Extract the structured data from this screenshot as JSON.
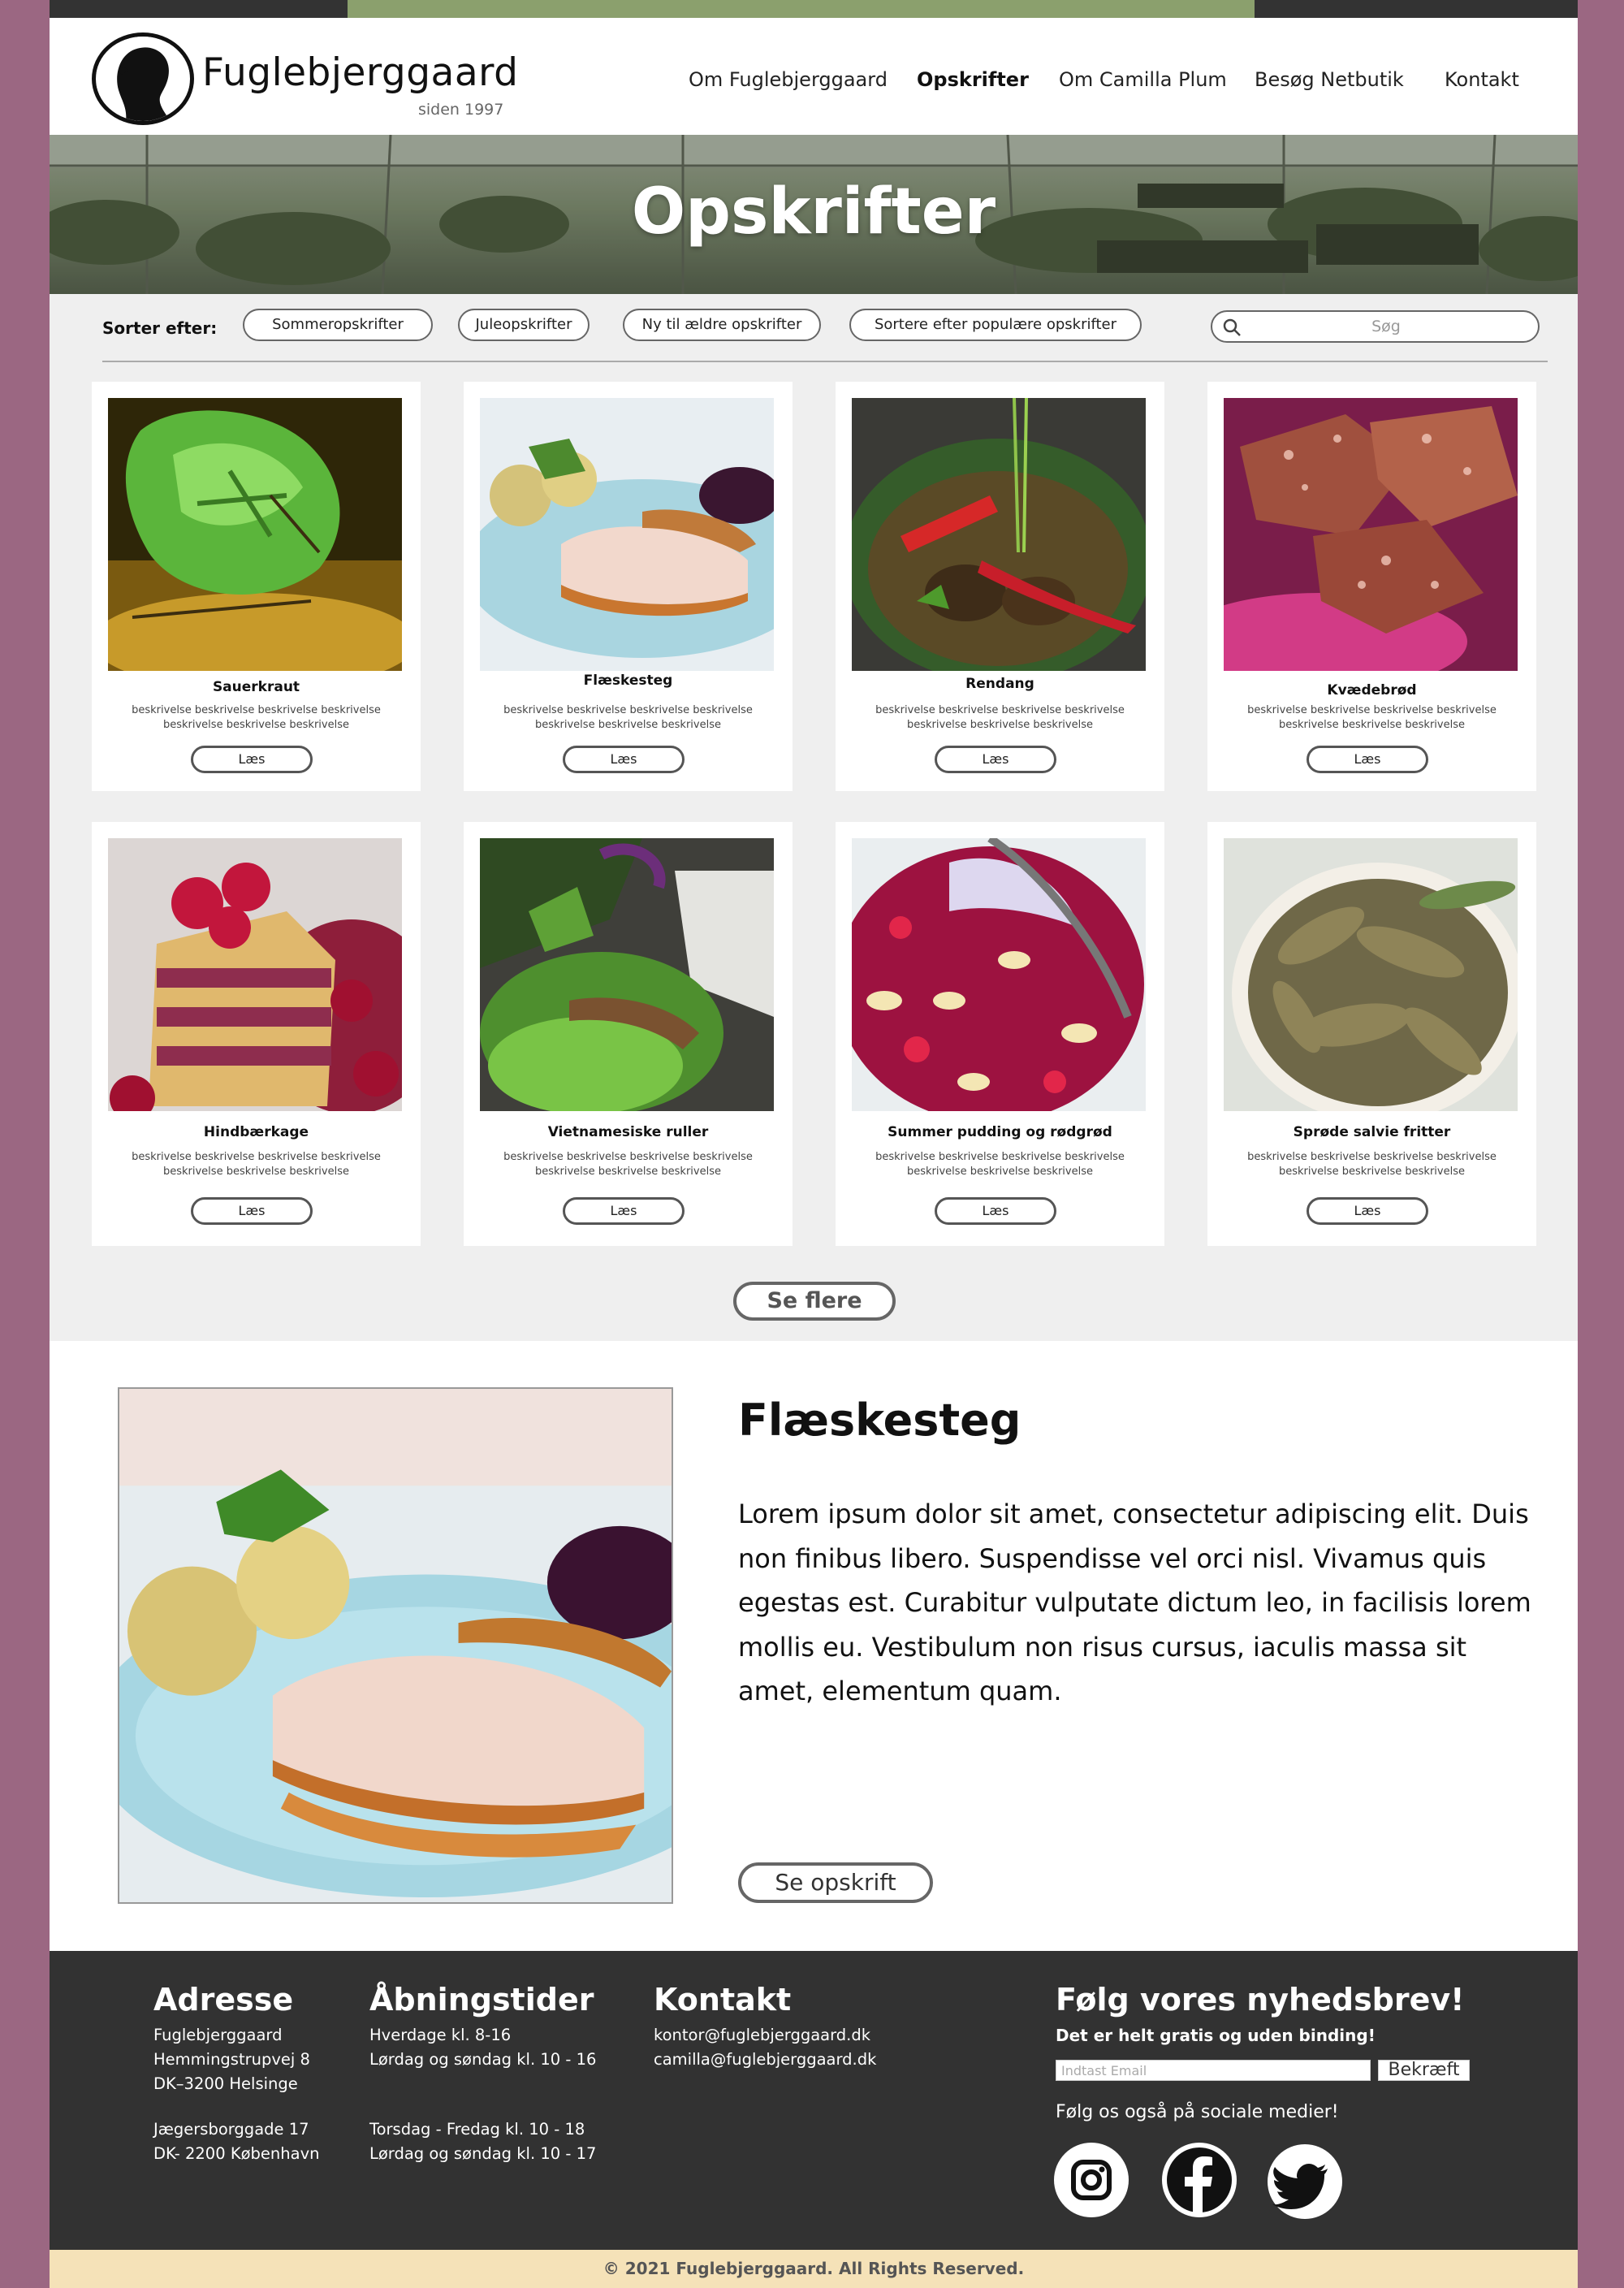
{
  "brand": {
    "name": "Fuglebjerggaard",
    "since": "siden 1997"
  },
  "nav": [
    {
      "label": "Om Fuglebjerggaard",
      "active": false
    },
    {
      "label": "Opskrifter",
      "active": true
    },
    {
      "label": "Om Camilla Plum",
      "active": false
    },
    {
      "label": "Besøg Netbutik",
      "active": false
    },
    {
      "label": "Kontakt",
      "active": false
    }
  ],
  "hero": {
    "title": "Opskrifter"
  },
  "filters": {
    "label": "Sorter efter:",
    "options": [
      "Sommeropskrifter",
      "Juleopskrifter",
      "Ny til ældre opskrifter",
      "Sortere efter populære opskrifter"
    ],
    "search_placeholder": "Søg"
  },
  "recipes": [
    {
      "title": "Sauerkraut",
      "desc": "beskrivelse beskrivelse beskrivelse beskrivelse beskrivelse beskrivelse beskrivelse",
      "button": "Læs"
    },
    {
      "title": "Flæskesteg",
      "desc": "beskrivelse beskrivelse beskrivelse beskrivelse beskrivelse beskrivelse beskrivelse",
      "button": "Læs"
    },
    {
      "title": "Rendang",
      "desc": "beskrivelse beskrivelse beskrivelse beskrivelse beskrivelse beskrivelse beskrivelse",
      "button": "Læs"
    },
    {
      "title": "Kvædebrød",
      "desc": "beskrivelse beskrivelse beskrivelse beskrivelse beskrivelse beskrivelse beskrivelse",
      "button": "Læs"
    },
    {
      "title": "Hindbærkage",
      "desc": "beskrivelse beskrivelse beskrivelse beskrivelse beskrivelse beskrivelse beskrivelse",
      "button": "Læs"
    },
    {
      "title": "Vietnamesiske ruller",
      "desc": "beskrivelse beskrivelse beskrivelse beskrivelse beskrivelse beskrivelse beskrivelse",
      "button": "Læs"
    },
    {
      "title": "Summer pudding og rødgrød",
      "desc": "beskrivelse beskrivelse beskrivelse beskrivelse beskrivelse beskrivelse beskrivelse",
      "button": "Læs"
    },
    {
      "title": "Sprøde salvie fritter",
      "desc": "beskrivelse beskrivelse beskrivelse beskrivelse beskrivelse beskrivelse beskrivelse",
      "button": "Læs"
    }
  ],
  "more_button": "Se flere",
  "featured": {
    "title": "Flæskesteg",
    "text": "Lorem ipsum dolor sit amet, consectetur adipiscing elit. Duis non finibus libero. Suspendisse vel orci nisl. Vivamus quis egestas est. Curabitur vulputate dictum leo, in facilisis lorem mollis eu. Vestibulum non risus cursus, iaculis massa sit amet, elementum quam.",
    "button": "Se opskrift"
  },
  "footer": {
    "address": {
      "heading": "Adresse",
      "lines": [
        "Fuglebjerggaard",
        "Hemmingstrupvej 8",
        "DK–3200 Helsinge",
        "Jægersborggade 17",
        "DK- 2200 København"
      ]
    },
    "hours": {
      "heading": "Åbningstider",
      "lines": [
        "Hverdage kl. 8-16",
        "Lørdag og søndag kl. 10 - 16",
        "Torsdag - Fredag kl. 10 - 18",
        "Lørdag og søndag kl. 10 - 17"
      ]
    },
    "contact": {
      "heading": "Kontakt",
      "lines": [
        "kontor@fuglebjerggaard.dk",
        "camilla@fuglebjerggaard.dk"
      ]
    },
    "newsletter": {
      "heading": "Følg vores nyhedsbrev!",
      "subheading": "Det er helt gratis og uden binding!",
      "email_placeholder": "Indtast Email",
      "confirm": "Bekræft",
      "follow": "Følg os også på sociale medier!"
    },
    "social": [
      "instagram-icon",
      "facebook-icon",
      "twitter-icon"
    ]
  },
  "copyright": "© 2021 Fuglebjerggaard. All Rights Reserved.",
  "colors": {
    "accent_green": "#8ba06d",
    "side_purple": "#9b6782",
    "footer_dark": "#323232",
    "copyright_bg": "#f5e2b8"
  }
}
